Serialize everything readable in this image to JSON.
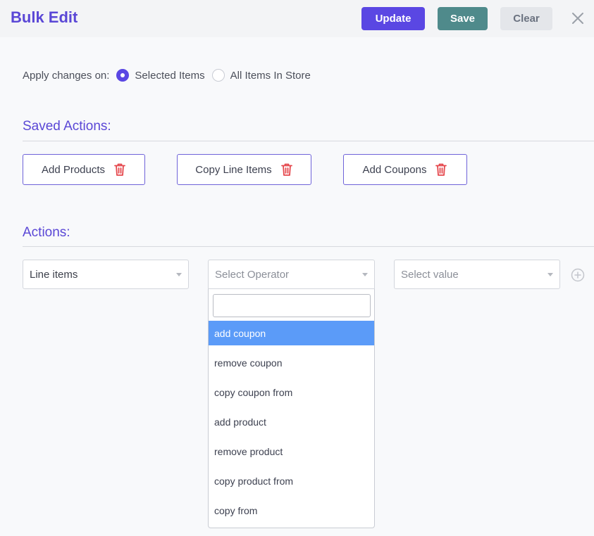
{
  "header": {
    "title": "Bulk Edit",
    "update_label": "Update",
    "save_label": "Save",
    "clear_label": "Clear"
  },
  "apply": {
    "label": "Apply changes on:",
    "options": [
      "Selected Items",
      "All Items In Store"
    ],
    "selected": "Selected Items"
  },
  "saved_actions": {
    "title": "Saved Actions:",
    "items": [
      "Add Products",
      "Copy Line Items",
      "Add Coupons"
    ]
  },
  "actions": {
    "title": "Actions:",
    "field_value": "Line items",
    "operator_placeholder": "Select Operator",
    "value_placeholder": "Select value"
  },
  "dropdown": {
    "search_value": "",
    "options": [
      "add coupon",
      "remove coupon",
      "copy coupon from",
      "add product",
      "remove product",
      "copy product from",
      "copy from"
    ],
    "highlighted": "add coupon"
  },
  "colors": {
    "accent": "#5a47e3",
    "save": "#4f8a8b",
    "highlight": "#5b9bf8",
    "trash": "#e5484d"
  },
  "icons": {
    "close": "close-icon",
    "trash": "trash-icon",
    "add": "plus-circle-icon"
  }
}
